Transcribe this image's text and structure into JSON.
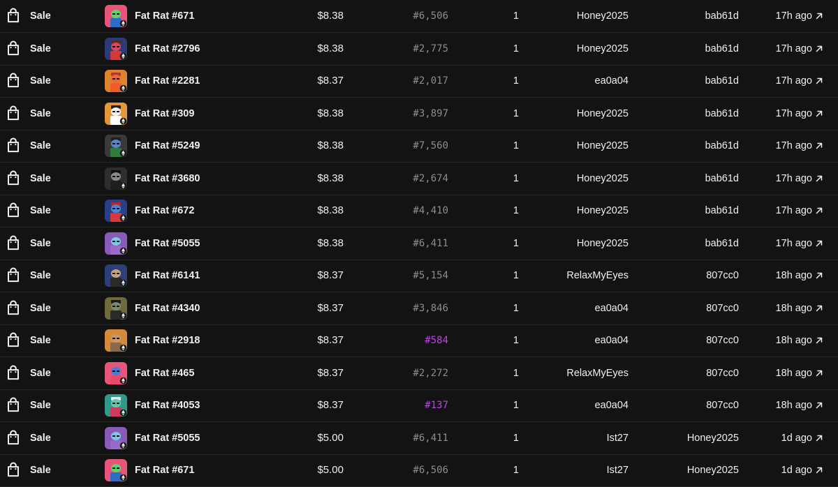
{
  "activity": {
    "rows": [
      {
        "event": "Sale",
        "item": "Fat Rat #671",
        "price": "$8.38",
        "rarity": "#6,506",
        "rare": false,
        "qty": "1",
        "from": "Honey2025",
        "to": "bab61d",
        "time": "17h ago",
        "bg": "#e9557a",
        "fur": "#5fd36a",
        "outfit": "#2f6cc9",
        "hat": "#e9557a"
      },
      {
        "event": "Sale",
        "item": "Fat Rat #2796",
        "price": "$8.38",
        "rarity": "#2,775",
        "rare": false,
        "qty": "1",
        "from": "Honey2025",
        "to": "bab61d",
        "time": "17h ago",
        "bg": "#2d3a78",
        "fur": "#d8475a",
        "outfit": "#d23a3a",
        "hat": "#5a2a22"
      },
      {
        "event": "Sale",
        "item": "Fat Rat #2281",
        "price": "$8.37",
        "rarity": "#2,017",
        "rare": false,
        "qty": "1",
        "from": "ea0a04",
        "to": "bab61d",
        "time": "17h ago",
        "bg": "#e0842c",
        "fur": "#ef6a3a",
        "outfit": "#ef5b2a",
        "hat": "#b23a2a"
      },
      {
        "event": "Sale",
        "item": "Fat Rat #309",
        "price": "$8.38",
        "rarity": "#3,897",
        "rare": false,
        "qty": "1",
        "from": "Honey2025",
        "to": "bab61d",
        "time": "17h ago",
        "bg": "#e6963a",
        "fur": "#f2f2f2",
        "outfit": "#ffffff",
        "hat": "#222222"
      },
      {
        "event": "Sale",
        "item": "Fat Rat #5249",
        "price": "$8.38",
        "rarity": "#7,560",
        "rare": false,
        "qty": "1",
        "from": "Honey2025",
        "to": "bab61d",
        "time": "17h ago",
        "bg": "#3a3a3a",
        "fur": "#5b84c7",
        "outfit": "#2e7d3a",
        "hat": "#1e1e1e"
      },
      {
        "event": "Sale",
        "item": "Fat Rat #3680",
        "price": "$8.38",
        "rarity": "#2,674",
        "rare": false,
        "qty": "1",
        "from": "Honey2025",
        "to": "bab61d",
        "time": "17h ago",
        "bg": "#2e2e2e",
        "fur": "#8a8a8a",
        "outfit": "#1f1f1f",
        "hat": "#111111"
      },
      {
        "event": "Sale",
        "item": "Fat Rat #672",
        "price": "$8.38",
        "rarity": "#4,410",
        "rare": false,
        "qty": "1",
        "from": "Honey2025",
        "to": "bab61d",
        "time": "17h ago",
        "bg": "#2a3f8a",
        "fur": "#4a86d8",
        "outfit": "#d53a3a",
        "hat": "#b0282a"
      },
      {
        "event": "Sale",
        "item": "Fat Rat #5055",
        "price": "$8.38",
        "rarity": "#6,411",
        "rare": false,
        "qty": "1",
        "from": "Honey2025",
        "to": "bab61d",
        "time": "17h ago",
        "bg": "#8a5ab8",
        "fur": "#7cc7e8",
        "outfit": "#9a6ac8",
        "hat": "#8a5ab8"
      },
      {
        "event": "Sale",
        "item": "Fat Rat #6141",
        "price": "$8.37",
        "rarity": "#5,154",
        "rare": false,
        "qty": "1",
        "from": "RelaxMyEyes",
        "to": "807cc0",
        "time": "18h ago",
        "bg": "#2d3f78",
        "fur": "#c9a27a",
        "outfit": "#2a2a2a",
        "hat": "#2d3f78"
      },
      {
        "event": "Sale",
        "item": "Fat Rat #4340",
        "price": "$8.37",
        "rarity": "#3,846",
        "rare": false,
        "qty": "1",
        "from": "ea0a04",
        "to": "807cc0",
        "time": "18h ago",
        "bg": "#6e6a3a",
        "fur": "#7a8a6a",
        "outfit": "#2a2a2a",
        "hat": "#1a1a1a"
      },
      {
        "event": "Sale",
        "item": "Fat Rat #2918",
        "price": "$8.37",
        "rarity": "#584",
        "rare": true,
        "qty": "1",
        "from": "ea0a04",
        "to": "807cc0",
        "time": "18h ago",
        "bg": "#d48a3a",
        "fur": "#c89a6a",
        "outfit": "#8a6a4a",
        "hat": "#d48a3a"
      },
      {
        "event": "Sale",
        "item": "Fat Rat #465",
        "price": "$8.37",
        "rarity": "#2,272",
        "rare": false,
        "qty": "1",
        "from": "RelaxMyEyes",
        "to": "807cc0",
        "time": "18h ago",
        "bg": "#e9557a",
        "fur": "#4a7ad8",
        "outfit": "#e94a6a",
        "hat": "#e9557a"
      },
      {
        "event": "Sale",
        "item": "Fat Rat #4053",
        "price": "$8.37",
        "rarity": "#137",
        "rare": true,
        "qty": "1",
        "from": "ea0a04",
        "to": "807cc0",
        "time": "18h ago",
        "bg": "#2f9a8a",
        "fur": "#5fc9b0",
        "outfit": "#d23a5a",
        "hat": "#e8e8e8"
      },
      {
        "event": "Sale",
        "item": "Fat Rat #5055",
        "price": "$5.00",
        "rarity": "#6,411",
        "rare": false,
        "qty": "1",
        "from": "Ist27",
        "to": "Honey2025",
        "time": "1d ago",
        "bg": "#8a5ab8",
        "fur": "#7cc7e8",
        "outfit": "#9a6ac8",
        "hat": "#8a5ab8"
      },
      {
        "event": "Sale",
        "item": "Fat Rat #671",
        "price": "$5.00",
        "rarity": "#6,506",
        "rare": false,
        "qty": "1",
        "from": "Ist27",
        "to": "Honey2025",
        "time": "1d ago",
        "bg": "#e9557a",
        "fur": "#5fd36a",
        "outfit": "#2f6cc9",
        "hat": "#e9557a"
      }
    ]
  },
  "icons": {
    "event": "shopping-bag-icon",
    "chain": "ethereum-icon",
    "link": "arrow-up-right-icon"
  },
  "colors": {
    "background": "#131313",
    "divider": "#262626",
    "text": "#f0f0f0",
    "muted": "#8d8d8d",
    "rare_accent": "#c43ef2"
  }
}
